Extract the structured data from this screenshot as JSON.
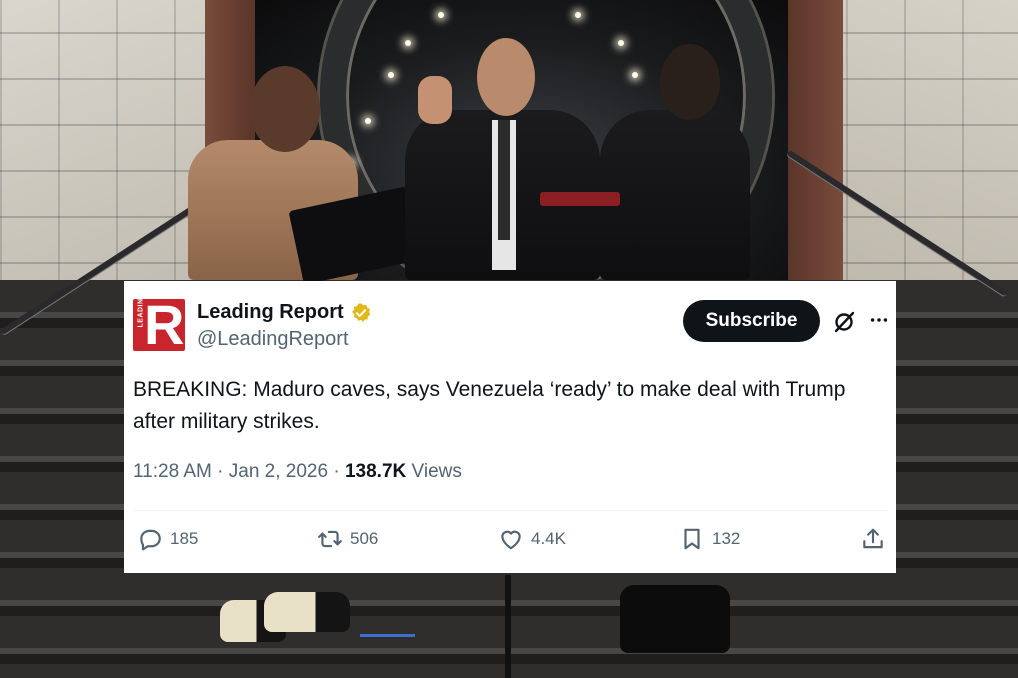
{
  "tweet": {
    "author_name": "Leading Report",
    "handle": "@LeadingReport",
    "logo_letter": "R",
    "logo_small_text": "LEADING",
    "subscribe_label": "Subscribe",
    "text": "BREAKING: Maduro caves, says Venezuela ‘ready’ to make deal with Trump after military strikes.",
    "time": "11:28 AM",
    "date": "Jan 2, 2026",
    "separator": "·",
    "views_count": "138.7K",
    "views_label": "Views",
    "replies": "185",
    "reposts": "506",
    "likes": "4.4K",
    "bookmarks": "132"
  },
  "icons": {
    "verified": "verified-badge-icon",
    "grok": "grok-icon",
    "more": "more-icon",
    "reply": "reply-icon",
    "repost": "repost-icon",
    "like": "like-icon",
    "bookmark": "bookmark-icon",
    "share": "share-icon"
  },
  "colors": {
    "logo_red": "#c8262c",
    "verified_gold": "#e2b719",
    "text_primary": "#0f1419",
    "text_secondary": "#536471",
    "button_dark": "#0f1419"
  }
}
